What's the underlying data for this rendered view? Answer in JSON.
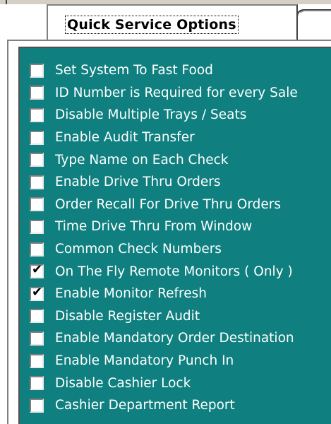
{
  "tabs": {
    "active_label": "Quick Service Options"
  },
  "options": [
    {
      "label": "Set System To Fast Food",
      "checked": false
    },
    {
      "label": "ID Number is Required for every Sale",
      "checked": false
    },
    {
      "label": "Disable Multiple Trays / Seats",
      "checked": false
    },
    {
      "label": "Enable Audit Transfer",
      "checked": false
    },
    {
      "label": "Type Name on Each Check",
      "checked": false
    },
    {
      "label": "Enable Drive Thru Orders",
      "checked": false
    },
    {
      "label": "Order Recall For Drive Thru Orders",
      "checked": false
    },
    {
      "label": "Time Drive Thru From Window",
      "checked": false
    },
    {
      "label": "Common Check Numbers",
      "checked": false
    },
    {
      "label": "On The Fly Remote Monitors ( Only )",
      "checked": true
    },
    {
      "label": "Enable Monitor Refresh",
      "checked": true
    },
    {
      "label": "Disable Register Audit",
      "checked": false
    },
    {
      "label": "Enable Mandatory Order Destination",
      "checked": false
    },
    {
      "label": "Enable Mandatory Punch In",
      "checked": false
    },
    {
      "label": "Disable Cashier Lock",
      "checked": false
    },
    {
      "label": "Cashier Department Report",
      "checked": false
    }
  ],
  "colors": {
    "panel_background": "#0f7f7f",
    "label_text": "#ffffff"
  },
  "icons": {
    "checkmark": "✔"
  }
}
